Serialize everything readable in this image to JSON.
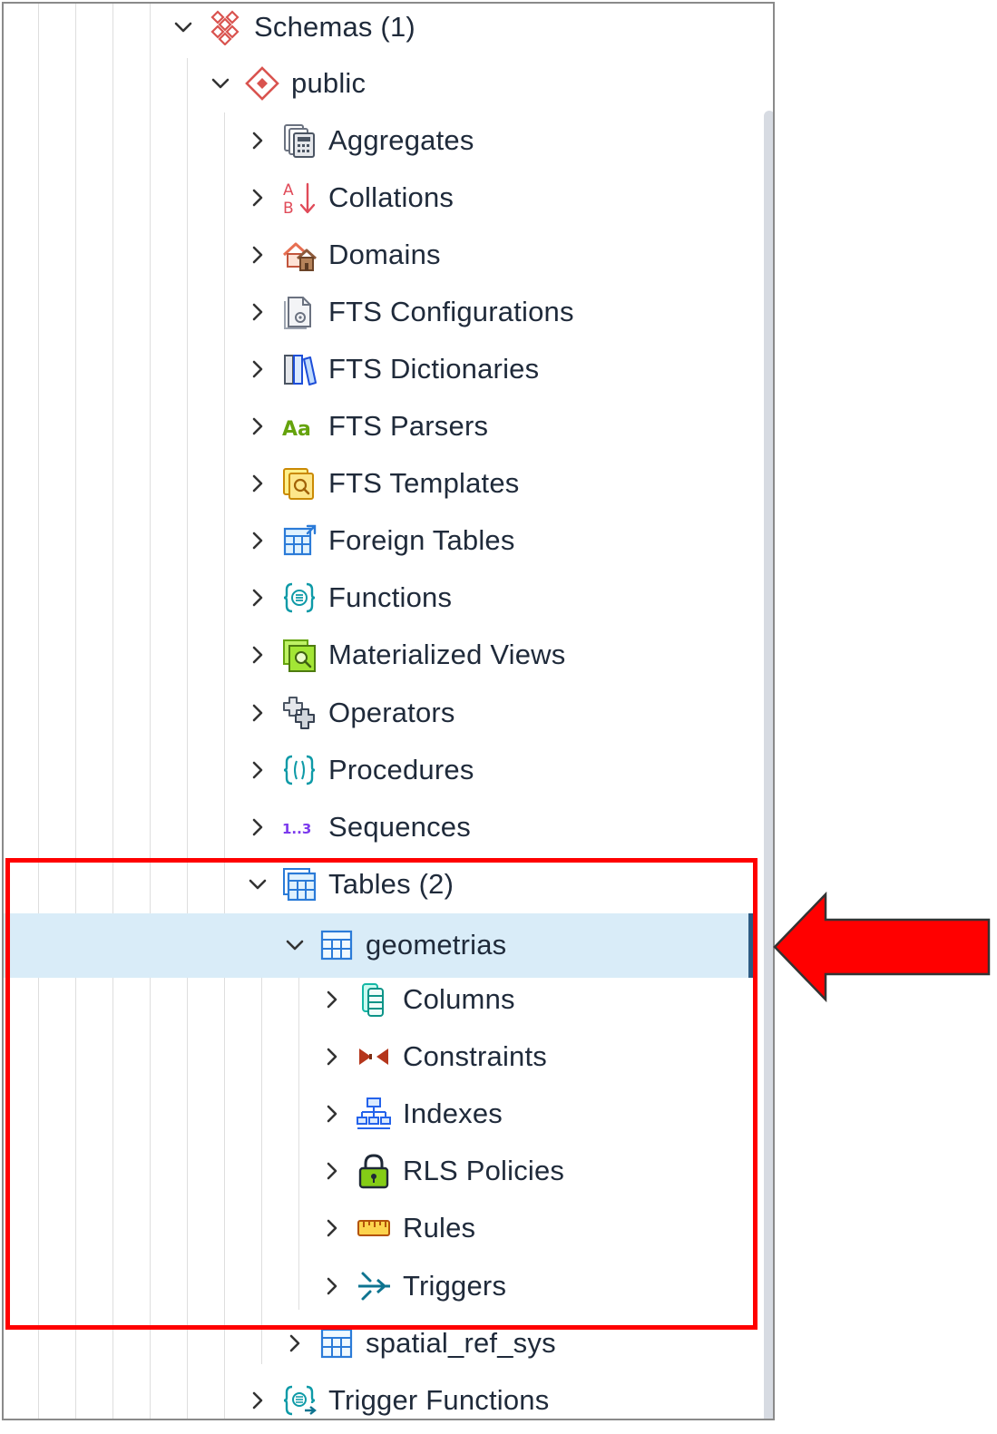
{
  "tree": {
    "schemas": "Schemas (1)",
    "public": "public",
    "aggregates": "Aggregates",
    "collations": "Collations",
    "domains": "Domains",
    "fts_configurations": "FTS Configurations",
    "fts_dictionaries": "FTS Dictionaries",
    "fts_parsers": "FTS Parsers",
    "fts_templates": "FTS Templates",
    "foreign_tables": "Foreign Tables",
    "functions": "Functions",
    "materialized_views": "Materialized Views",
    "operators": "Operators",
    "procedures": "Procedures",
    "sequences": "Sequences",
    "tables": "Tables (2)",
    "geometrias": "geometrias",
    "columns": "Columns",
    "constraints": "Constraints",
    "indexes": "Indexes",
    "rls_policies": "RLS Policies",
    "rules": "Rules",
    "triggers": "Triggers",
    "spatial_ref_sys": "spatial_ref_sys",
    "trigger_functions": "Trigger Functions"
  },
  "icons": {
    "parsers_glyph": "Aa",
    "sequences_glyph": "1..3"
  },
  "colors": {
    "selection": "#d9ecf8",
    "annotation": "#ff0000"
  }
}
